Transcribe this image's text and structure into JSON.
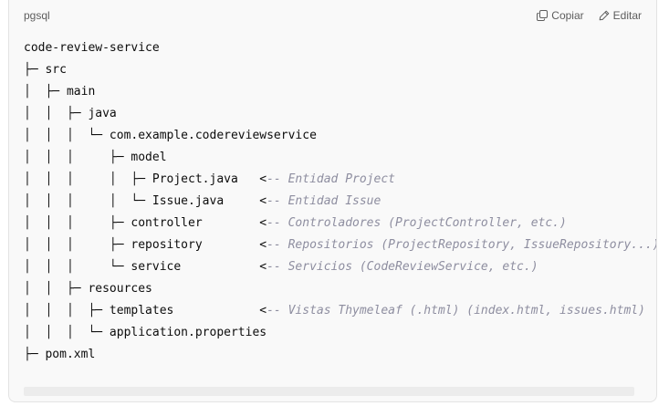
{
  "code_block": {
    "language": "pgsql",
    "copy_label": "Copiar",
    "edit_label": "Editar",
    "copy_icon": "copy-icon",
    "edit_icon": "pencil-icon",
    "lines": [
      {
        "code": "code-review-service",
        "comment": ""
      },
      {
        "code": "├─ src",
        "comment": ""
      },
      {
        "code": "│  ├─ main",
        "comment": ""
      },
      {
        "code": "│  │  ├─ java",
        "comment": ""
      },
      {
        "code": "│  │  │  └─ com.example.codereviewservice",
        "comment": ""
      },
      {
        "code": "│  │  │     ├─ model",
        "comment": ""
      },
      {
        "code": "│  │  │     │  ├─ Project.java   ",
        "comment": "<-- Entidad Project"
      },
      {
        "code": "│  │  │     │  └─ Issue.java     ",
        "comment": "<-- Entidad Issue"
      },
      {
        "code": "│  │  │     ├─ controller        ",
        "comment": "<-- Controladores (ProjectController, etc.)"
      },
      {
        "code": "│  │  │     ├─ repository        ",
        "comment": "<-- Repositorios (ProjectRepository, IssueRepository...)"
      },
      {
        "code": "│  │  │     └─ service           ",
        "comment": "<-- Servicios (CodeReviewService, etc.)"
      },
      {
        "code": "│  │  ├─ resources",
        "comment": ""
      },
      {
        "code": "│  │  │  ├─ templates            ",
        "comment": "<-- Vistas Thymeleaf (.html) (index.html, issues.html)"
      },
      {
        "code": "│  │  │  └─ application.properties",
        "comment": ""
      },
      {
        "code": "├─ pom.xml",
        "comment": ""
      }
    ]
  },
  "colors": {
    "card_background": "#f9f9f9",
    "border": "#e3e3e3",
    "text": "#0d0d0d",
    "comment": "#8e8ea0",
    "header_text": "#5d5d5d"
  }
}
